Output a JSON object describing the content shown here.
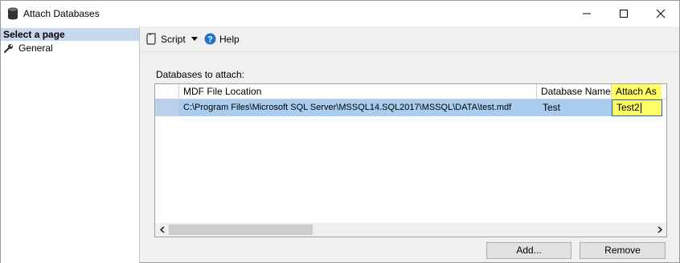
{
  "window": {
    "title": "Attach Databases"
  },
  "left_pane": {
    "section_title": "Select a page",
    "pages": [
      {
        "label": "General"
      }
    ]
  },
  "toolbar": {
    "script_label": "Script",
    "help_label": "Help"
  },
  "main": {
    "group_label": "Databases to attach:",
    "table": {
      "columns": [
        "MDF File Location",
        "Database Name",
        "Attach As"
      ],
      "rows": [
        {
          "mdf_location": "C:\\Program Files\\Microsoft SQL Server\\MSSQL14.SQL2017\\MSSQL\\DATA\\test.mdf",
          "browse_label": "...",
          "database_name": "Test",
          "attach_as": "Test2"
        }
      ]
    },
    "buttons": {
      "add": "Add...",
      "remove": "Remove"
    }
  },
  "colors": {
    "selection": "#a8cdef",
    "highlight_yellow": "#ffff66",
    "section_header": "#c8d9ec",
    "help_icon_blue": "#1e74c9"
  }
}
